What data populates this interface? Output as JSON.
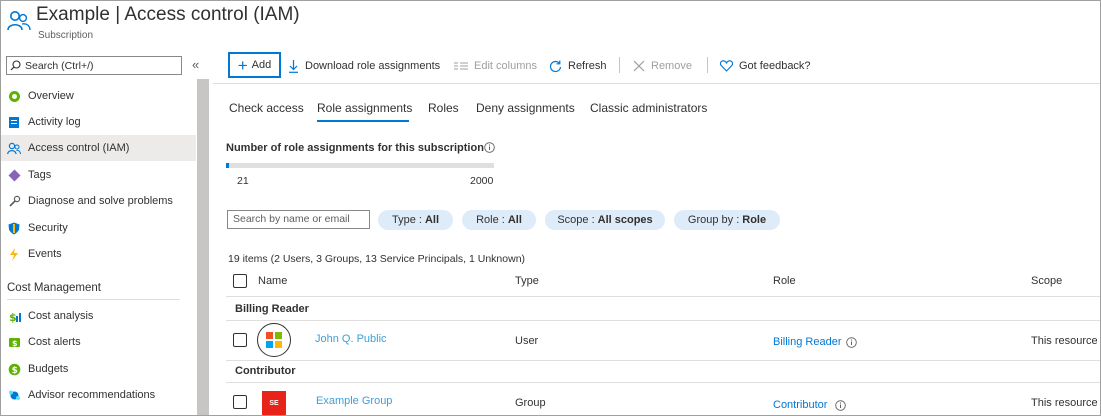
{
  "header": {
    "title": "Example | Access control (IAM)",
    "subtitle": "Subscription"
  },
  "sidebar": {
    "search_placeholder": "Search (Ctrl+/)",
    "items": [
      {
        "label": "Overview",
        "icon": "overview-icon"
      },
      {
        "label": "Activity log",
        "icon": "activity-log-icon"
      },
      {
        "label": "Access control (IAM)",
        "icon": "people-icon",
        "active": true
      },
      {
        "label": "Tags",
        "icon": "tag-icon"
      },
      {
        "label": "Diagnose and solve problems",
        "icon": "wrench-icon"
      },
      {
        "label": "Security",
        "icon": "shield-icon"
      },
      {
        "label": "Events",
        "icon": "lightning-icon"
      }
    ],
    "section_header": "Cost Management",
    "section_items": [
      {
        "label": "Cost analysis",
        "icon": "cost-analysis-icon"
      },
      {
        "label": "Cost alerts",
        "icon": "cost-alerts-icon"
      },
      {
        "label": "Budgets",
        "icon": "budgets-icon"
      },
      {
        "label": "Advisor recommendations",
        "icon": "advisor-icon"
      }
    ]
  },
  "toolbar": {
    "add": "Add",
    "download": "Download role assignments",
    "edit_columns": "Edit columns",
    "refresh": "Refresh",
    "remove": "Remove",
    "feedback": "Got feedback?"
  },
  "tabs": [
    {
      "label": "Check access"
    },
    {
      "label": "Role assignments",
      "active": true
    },
    {
      "label": "Roles"
    },
    {
      "label": "Deny assignments"
    },
    {
      "label": "Classic administrators"
    }
  ],
  "assignments": {
    "label": "Number of role assignments for this subscription",
    "current": "21",
    "max": "2000",
    "fill_fraction": 0.0105
  },
  "filters": {
    "search_placeholder": "Search by name or email",
    "type_label": "Type :",
    "type_value": "All",
    "role_label": "Role :",
    "role_value": "All",
    "scope_label": "Scope :",
    "scope_value": "All scopes",
    "groupby_label": "Group by :",
    "groupby_value": "Role"
  },
  "table": {
    "summary": "19 items (2 Users, 3 Groups, 13 Service Principals, 1 Unknown)",
    "columns": {
      "name": "Name",
      "type": "Type",
      "role": "Role",
      "scope": "Scope"
    },
    "groups": [
      {
        "name": "Billing Reader",
        "rows": [
          {
            "name": "John Q. Public",
            "type": "User",
            "role": "Billing Reader",
            "scope": "This resource",
            "avatar": "microsoft-logo"
          }
        ]
      },
      {
        "name": "Contributor",
        "rows": [
          {
            "name": "Example Group",
            "type": "Group",
            "role": "Contributor",
            "scope": "This resource",
            "avatar_initials": "SE"
          }
        ]
      }
    ]
  },
  "colors": {
    "accent": "#0078d4",
    "pill_bg": "#deecf9",
    "avatar_red": "#e8231a"
  }
}
